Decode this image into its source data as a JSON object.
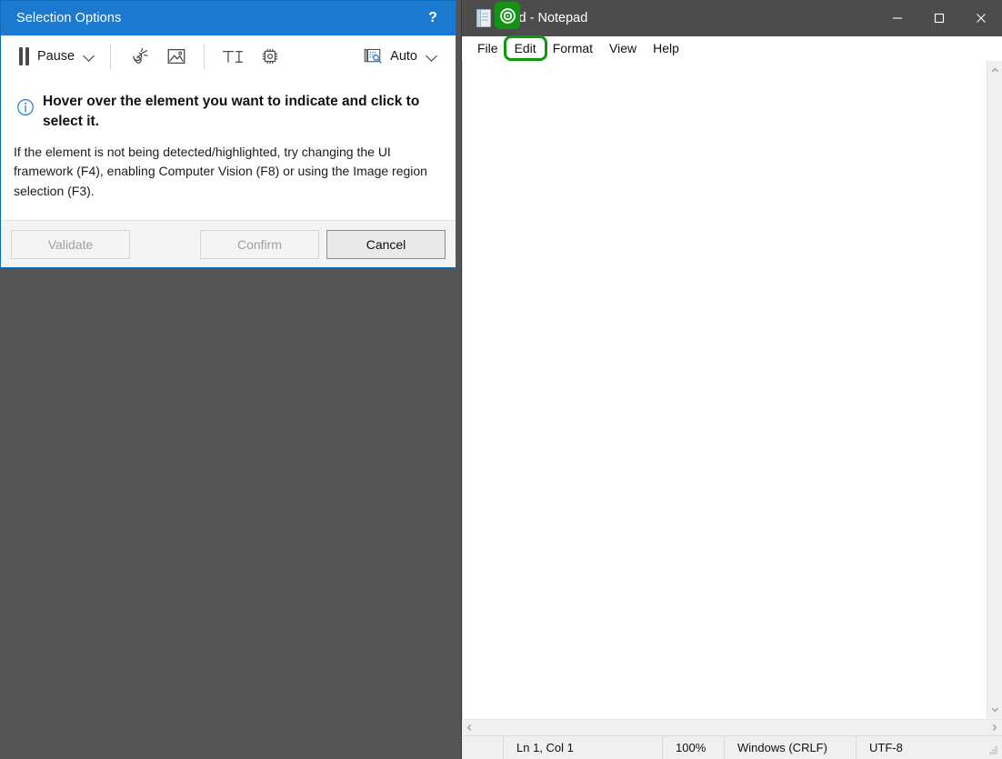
{
  "desktop": {
    "background_color": "#545454"
  },
  "selection_dialog": {
    "title": "Selection Options",
    "help_label": "?",
    "titlebar_color": "#1b79d0",
    "toolbar": {
      "pause_label": "Pause",
      "pause_icon": "pause-icon",
      "pause_dropdown_icon": "chevron-down-icon",
      "indicate_element_icon": "cursor-click-icon",
      "image_region_icon": "image-icon",
      "text_target_icon": "text-target-icon",
      "native_target_icon": "cpu-chip-icon",
      "auto_label": "Auto",
      "auto_icon": "auto-detect-icon",
      "auto_dropdown_icon": "chevron-down-icon"
    },
    "info": {
      "icon": "info-circle-icon",
      "headline": "Hover over the element you want to indicate and click to select it.",
      "details": "If the element is not being detected/highlighted, try changing the UI framework (F4), enabling Computer Vision (F8) or using the Image region selection (F3)."
    },
    "buttons": {
      "validate": {
        "label": "Validate",
        "enabled": false
      },
      "confirm": {
        "label": "Confirm",
        "enabled": false
      },
      "cancel": {
        "label": "Cancel",
        "enabled": true
      }
    }
  },
  "notepad": {
    "title": "itled - Notepad",
    "app_icon": "notepad-icon",
    "record_badge_icon": "record-target-icon",
    "record_badge_color": "#149414",
    "highlight_color": "#0c9a0c",
    "window_controls": {
      "minimize": "minimize-icon",
      "maximize": "maximize-icon",
      "close": "close-icon"
    },
    "menus": [
      {
        "label": "File",
        "highlighted": false
      },
      {
        "label": "Edit",
        "highlighted": true
      },
      {
        "label": "Format",
        "highlighted": false
      },
      {
        "label": "View",
        "highlighted": false
      },
      {
        "label": "Help",
        "highlighted": false
      }
    ],
    "editor": {
      "content": ""
    },
    "scrollbars": {
      "vertical_up": "chevron-up-icon",
      "vertical_down": "chevron-down-icon",
      "horizontal_left": "chevron-left-icon",
      "horizontal_right": "chevron-right-icon"
    },
    "statusbar": {
      "position": "Ln 1, Col 1",
      "zoom": "100%",
      "line_ending": "Windows (CRLF)",
      "encoding": "UTF-8",
      "grip": "resize-grip-icon"
    }
  }
}
